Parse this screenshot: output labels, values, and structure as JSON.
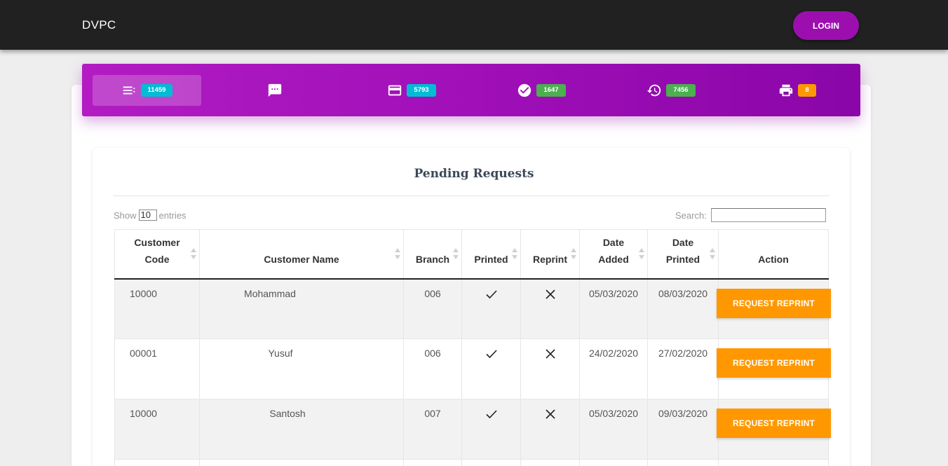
{
  "navbar": {
    "brand": "DVPC",
    "login_label": "LOGIN"
  },
  "stats": [
    {
      "icon": "list-icon",
      "count": "11459",
      "color": "#00bcd4",
      "active": true
    },
    {
      "icon": "message-icon",
      "count": "",
      "active": false
    },
    {
      "icon": "credit-card-icon",
      "count": "5793",
      "color": "#00bcd4",
      "active": false
    },
    {
      "icon": "check-circle-icon",
      "count": "1647",
      "color": "#4caf50",
      "active": false
    },
    {
      "icon": "history-icon",
      "count": "7456",
      "color": "#4caf50",
      "active": false
    },
    {
      "icon": "print-icon",
      "count": "8",
      "color": "#ff9800",
      "active": false
    }
  ],
  "page": {
    "title": "Pending Requests"
  },
  "table_controls": {
    "show_label": "Show",
    "entries_value": "10",
    "entries_label": "entries",
    "search_label": "Search:"
  },
  "table": {
    "columns": [
      "Customer Code",
      "Customer Name",
      "Branch",
      "Printed",
      "Reprint",
      "Date Added",
      "Date Printed",
      "Action"
    ],
    "rows": [
      {
        "code": "10000",
        "name": "Mohammad",
        "branch": "006",
        "printed": "check-icon",
        "reprint": "cross-icon",
        "date_added": "05/03/2020",
        "date_printed": "08/03/2020",
        "action": "REQUEST REPRINT"
      },
      {
        "code": "00001",
        "name": "Yusuf",
        "branch": "006",
        "printed": "check-icon",
        "reprint": "cross-icon",
        "date_added": "24/02/2020",
        "date_printed": "27/02/2020",
        "action": "REQUEST REPRINT"
      },
      {
        "code": "10000",
        "name": "Santosh",
        "branch": "007",
        "printed": "check-icon",
        "reprint": "cross-icon",
        "date_added": "05/03/2020",
        "date_printed": "09/03/2020",
        "action": "REQUEST REPRINT"
      }
    ]
  },
  "colors": {
    "primary": "#9c27b0",
    "accent_orange": "#ff9800",
    "cyan": "#00bcd4",
    "green": "#4caf50",
    "navbar": "#212121"
  }
}
